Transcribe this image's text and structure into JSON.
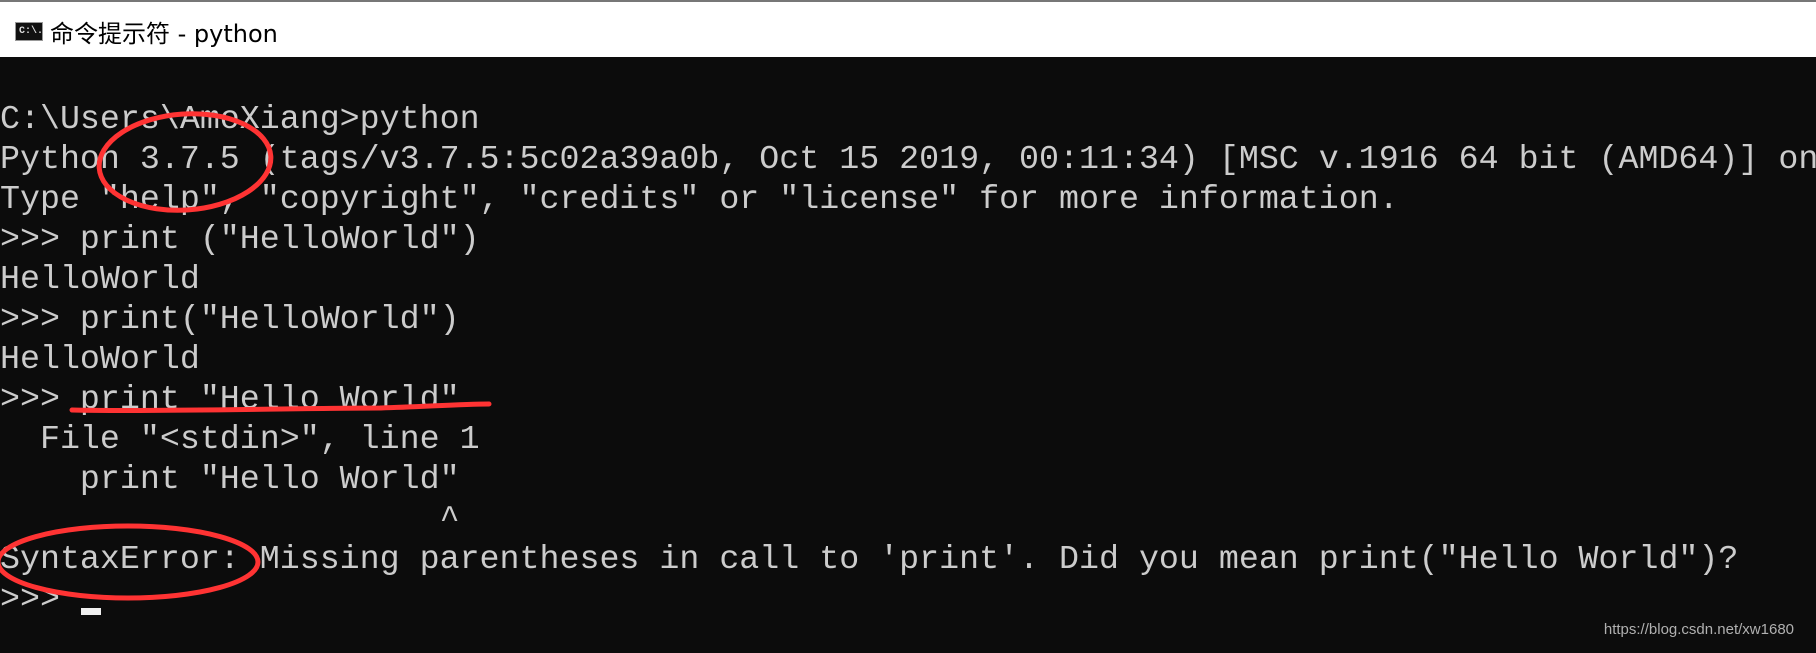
{
  "window": {
    "title": "命令提示符 - python",
    "icon": "cmd-icon",
    "icon_text": "C:\\."
  },
  "terminal": {
    "lines": [
      "C:\\Users\\AmoXiang>python",
      "Python 3.7.5 (tags/v3.7.5:5c02a39a0b, Oct 15 2019, 00:11:34) [MSC v.1916 64 bit (AMD64)] on",
      "Type \"help\", \"copyright\", \"credits\" or \"license\" for more information.",
      ">>> print (\"HelloWorld\")",
      "HelloWorld",
      ">>> print(\"HelloWorld\")",
      "HelloWorld",
      ">>> print \"Hello World\"",
      "  File \"<stdin>\", line 1",
      "    print \"Hello World\"",
      "                      ^",
      "SyntaxError: Missing parentheses in call to 'print'. Did you mean print(\"Hello World\")?",
      ">>> "
    ],
    "background": "#0c0c0c",
    "foreground": "#cccccc"
  },
  "annotations": {
    "color": "#ff3333"
  },
  "watermark": "https://blog.csdn.net/xw1680"
}
